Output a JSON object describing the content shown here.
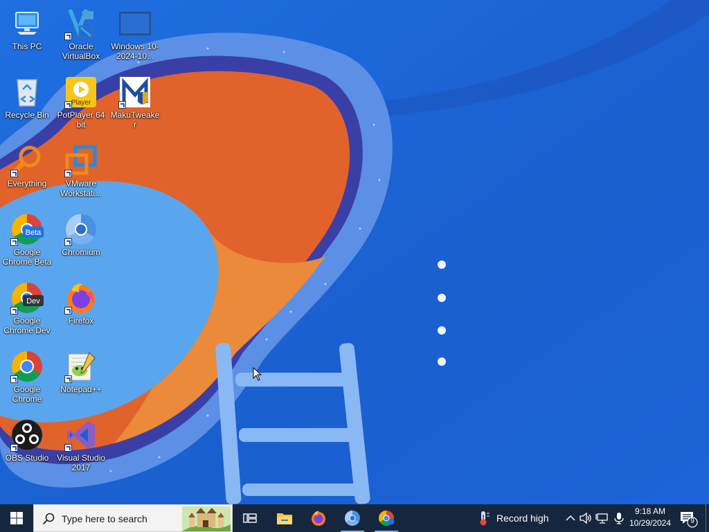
{
  "desktop": {
    "icons": [
      {
        "label": "This PC",
        "icon": "computer-icon"
      },
      {
        "label": "Oracle VirtualBox",
        "icon": "virtualbox-icon"
      },
      {
        "label": "Windows 10-2024-10...",
        "icon": "vm-screen-icon"
      },
      {
        "label": "Recycle Bin",
        "icon": "recycle-bin-icon"
      },
      {
        "label": "PotPlayer 64 bit",
        "icon": "potplayer-icon"
      },
      {
        "label": "MakuTweaker",
        "icon": "makutweaker-icon"
      },
      {
        "label": "Everything",
        "icon": "everything-search-icon"
      },
      {
        "label": "VMware Workstati...",
        "icon": "vmware-icon"
      },
      {
        "label": "Google Chrome Beta",
        "icon": "chrome-beta-icon"
      },
      {
        "label": "Chromium",
        "icon": "chromium-icon"
      },
      {
        "label": "Google Chrome Dev",
        "icon": "chrome-dev-icon"
      },
      {
        "label": "Firefox",
        "icon": "firefox-icon"
      },
      {
        "label": "Google Chrome",
        "icon": "chrome-icon"
      },
      {
        "label": "Notepad++",
        "icon": "notepadpp-icon"
      },
      {
        "label": "OBS Studio",
        "icon": "obs-icon"
      },
      {
        "label": "Visual Studio 2017",
        "icon": "visual-studio-icon"
      }
    ],
    "badges": {
      "beta": "Beta",
      "dev": "Dev",
      "player": "Player"
    }
  },
  "taskbar": {
    "search_placeholder": "Type here to search",
    "pinned": [
      {
        "name": "task-view",
        "icon": "task-view-icon"
      },
      {
        "name": "file-explorer",
        "icon": "folder-icon"
      },
      {
        "name": "firefox",
        "icon": "firefox-icon"
      },
      {
        "name": "chromium",
        "icon": "chromium-icon"
      },
      {
        "name": "chrome-beta",
        "icon": "chrome-beta-icon"
      }
    ],
    "weather_text": "Record high",
    "clock_time": "9:18 AM",
    "clock_date": "10/29/2024",
    "notification_count": "9"
  },
  "colors": {
    "wallpaper_blue": "#1a5fd0",
    "taskbar": "#16263d",
    "pool_orange": "#e2622c",
    "pool_water": "#5aa6ee"
  }
}
